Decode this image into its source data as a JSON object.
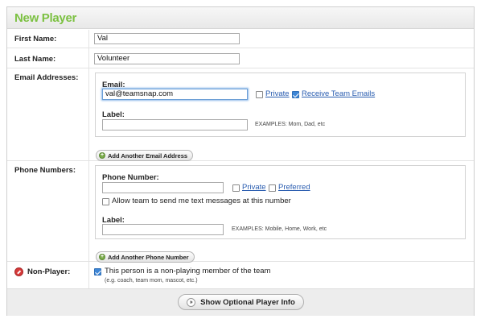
{
  "header": {
    "title": "New Player"
  },
  "first_name": {
    "label": "First Name:",
    "value": "Val"
  },
  "last_name": {
    "label": "Last Name:",
    "value": "Volunteer"
  },
  "email": {
    "section_label": "Email Addresses:",
    "field_label": "Email:",
    "value": "val@teamsnap.com",
    "private_label": "Private",
    "private_checked": false,
    "receive_label": "Receive Team Emails",
    "receive_checked": true,
    "label_label": "Label:",
    "label_value": "",
    "label_hint": "EXAMPLES: Mom, Dad, etc",
    "add_button": "Add Another Email Address"
  },
  "phone": {
    "section_label": "Phone Numbers:",
    "field_label": "Phone Number:",
    "value": "",
    "private_label": "Private",
    "private_checked": false,
    "preferred_label": "Preferred",
    "preferred_checked": false,
    "sms_label": "Allow team to send me text messages at this number",
    "sms_checked": false,
    "label_label": "Label:",
    "label_value": "",
    "label_hint": "EXAMPLES: Mobile, Home, Work, etc",
    "add_button": "Add Another Phone Number"
  },
  "non_player": {
    "label": "Non-Player:",
    "checked": true,
    "text": "This person is a non-playing member of the team",
    "hint": "(e.g. coach, team mom, mascot, etc.)"
  },
  "footer": {
    "show_optional_button": "Show Optional Player Info"
  },
  "icons": {
    "add": "plus-circle-icon",
    "non_player": "no-entry-icon",
    "expand": "double-chevron-down-icon"
  },
  "colors": {
    "title_green": "#7cc142",
    "link_blue": "#2a5db0",
    "checkbox_blue": "#3d86d6"
  }
}
